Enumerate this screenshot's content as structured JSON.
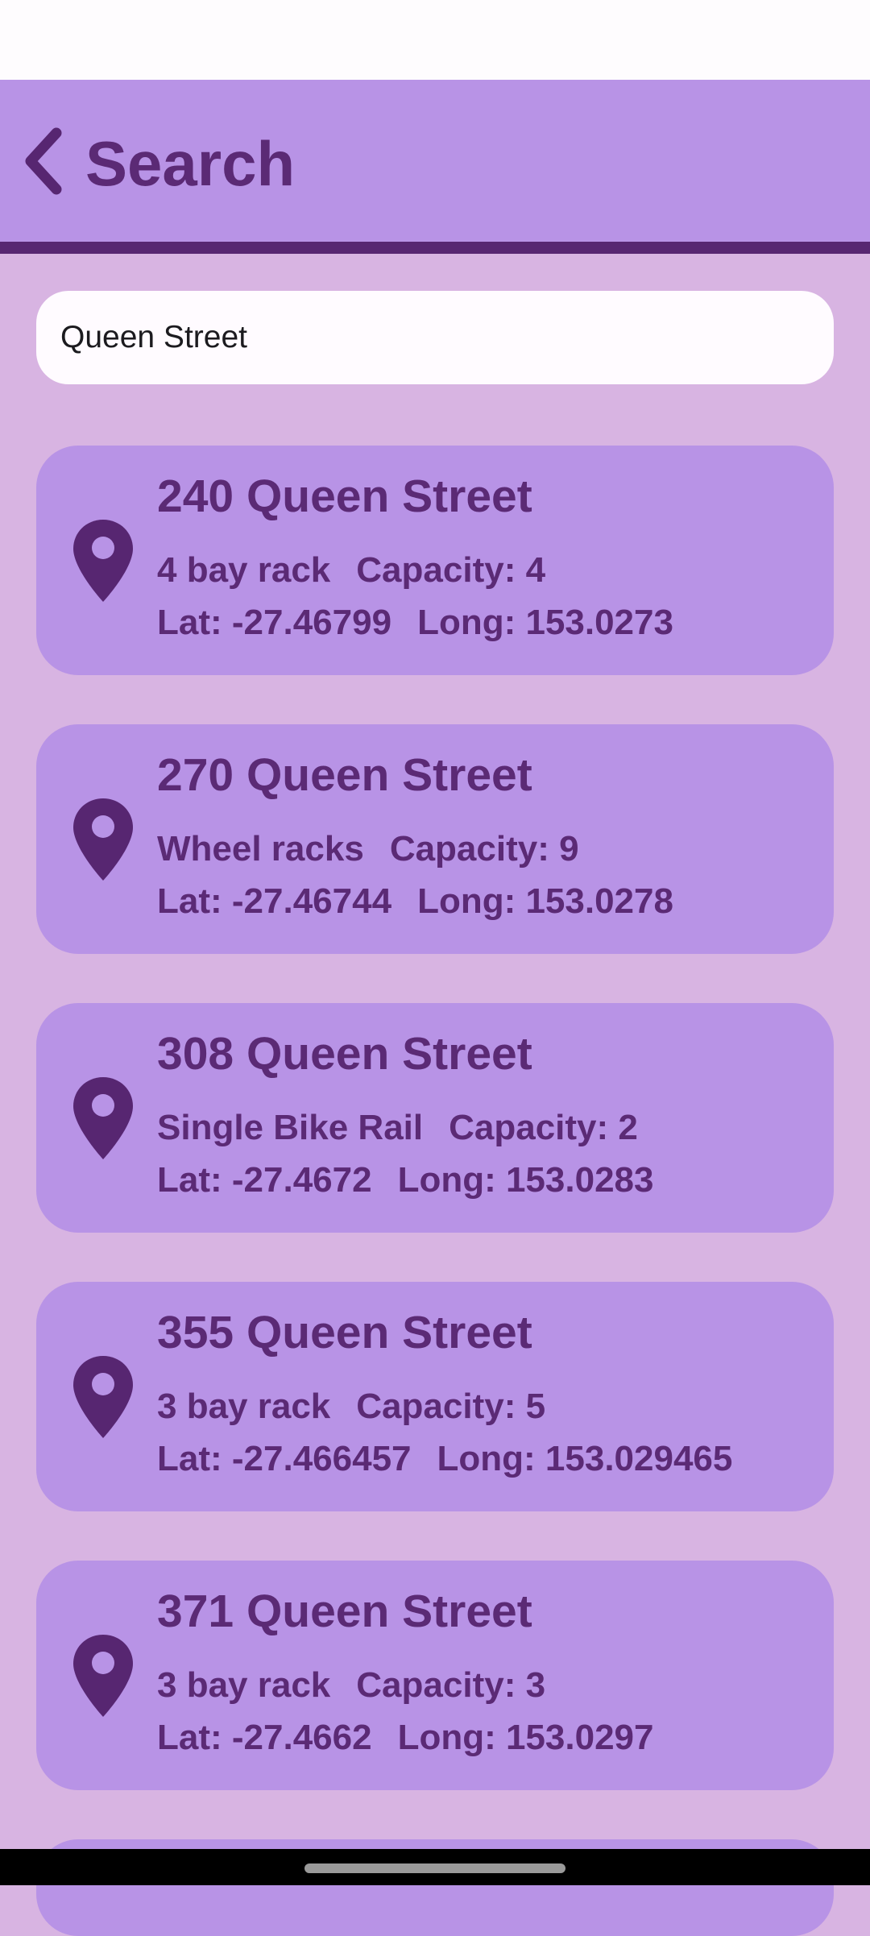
{
  "colors": {
    "background": "#d8b4e2",
    "app_bar": "#b893e6",
    "accent_dark": "#572671",
    "text_primary": "#5b2a75",
    "card": "#b893e6",
    "search_field": "#fffbff"
  },
  "header": {
    "back_icon": "chevron-left-icon",
    "title": "Search"
  },
  "search": {
    "value": "Queen Street",
    "placeholder": ""
  },
  "results": [
    {
      "icon": "location-pin-icon",
      "name": "240 Queen Street",
      "type": "4 bay rack",
      "capacity": "Capacity: 4",
      "lat": "Lat: -27.46799",
      "long": "Long: 153.0273"
    },
    {
      "icon": "location-pin-icon",
      "name": "270 Queen Street",
      "type": "Wheel racks",
      "capacity": "Capacity: 9",
      "lat": "Lat: -27.46744",
      "long": "Long: 153.0278"
    },
    {
      "icon": "location-pin-icon",
      "name": "308 Queen Street",
      "type": "Single Bike Rail",
      "capacity": "Capacity: 2",
      "lat": "Lat: -27.4672",
      "long": "Long: 153.0283"
    },
    {
      "icon": "location-pin-icon",
      "name": "355 Queen Street",
      "type": "3 bay rack",
      "capacity": "Capacity: 5",
      "lat": "Lat: -27.466457",
      "long": "Long: 153.029465"
    },
    {
      "icon": "location-pin-icon",
      "name": "371 Queen Street",
      "type": "3 bay rack",
      "capacity": "Capacity: 3",
      "lat": "Lat: -27.4662",
      "long": "Long: 153.0297"
    }
  ]
}
